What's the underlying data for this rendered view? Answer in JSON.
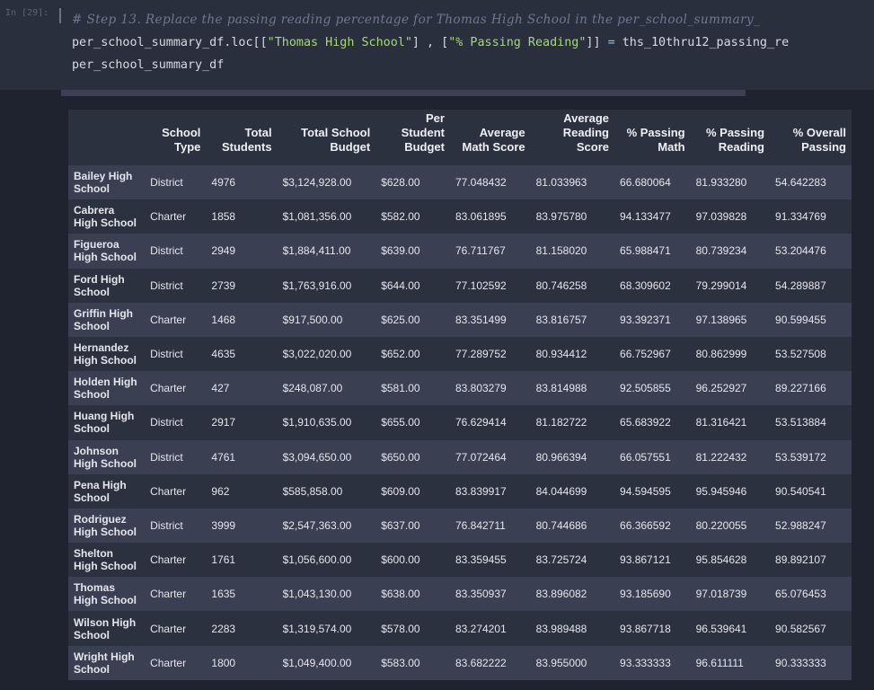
{
  "input_cell": {
    "prompt": "In [29]:",
    "comment": "# Step 13. Replace the passing reading percentage for Thomas High School in the per_school_summary_",
    "line2_pre": "per_school_summary_df.loc[[",
    "line2_str1": "\"Thomas High School\"",
    "line2_mid": "] , [",
    "line2_str2": "\"% Passing Reading\"",
    "line2_post": "]] ",
    "line2_eq": "=",
    "line2_tail": " ths_10thru12_passing_re",
    "line3": "per_school_summary_df"
  },
  "table": {
    "columns": [
      "School Type",
      "Total Students",
      "Total School Budget",
      "Per Student Budget",
      "Average Math Score",
      "Average Reading Score",
      "% Passing Math",
      "% Passing Reading",
      "% Overall Passing"
    ],
    "rows": [
      {
        "school": "Bailey High School",
        "cells": [
          "District",
          "4976",
          "$3,124,928.00",
          "$628.00",
          "77.048432",
          "81.033963",
          "66.680064",
          "81.933280",
          "54.642283"
        ]
      },
      {
        "school": "Cabrera High School",
        "cells": [
          "Charter",
          "1858",
          "$1,081,356.00",
          "$582.00",
          "83.061895",
          "83.975780",
          "94.133477",
          "97.039828",
          "91.334769"
        ]
      },
      {
        "school": "Figueroa High School",
        "cells": [
          "District",
          "2949",
          "$1,884,411.00",
          "$639.00",
          "76.711767",
          "81.158020",
          "65.988471",
          "80.739234",
          "53.204476"
        ]
      },
      {
        "school": "Ford High School",
        "cells": [
          "District",
          "2739",
          "$1,763,916.00",
          "$644.00",
          "77.102592",
          "80.746258",
          "68.309602",
          "79.299014",
          "54.289887"
        ]
      },
      {
        "school": "Griffin High School",
        "cells": [
          "Charter",
          "1468",
          "$917,500.00",
          "$625.00",
          "83.351499",
          "83.816757",
          "93.392371",
          "97.138965",
          "90.599455"
        ]
      },
      {
        "school": "Hernandez High School",
        "cells": [
          "District",
          "4635",
          "$3,022,020.00",
          "$652.00",
          "77.289752",
          "80.934412",
          "66.752967",
          "80.862999",
          "53.527508"
        ]
      },
      {
        "school": "Holden High School",
        "cells": [
          "Charter",
          "427",
          "$248,087.00",
          "$581.00",
          "83.803279",
          "83.814988",
          "92.505855",
          "96.252927",
          "89.227166"
        ]
      },
      {
        "school": "Huang High School",
        "cells": [
          "District",
          "2917",
          "$1,910,635.00",
          "$655.00",
          "76.629414",
          "81.182722",
          "65.683922",
          "81.316421",
          "53.513884"
        ]
      },
      {
        "school": "Johnson High School",
        "cells": [
          "District",
          "4761",
          "$3,094,650.00",
          "$650.00",
          "77.072464",
          "80.966394",
          "66.057551",
          "81.222432",
          "53.539172"
        ]
      },
      {
        "school": "Pena High School",
        "cells": [
          "Charter",
          "962",
          "$585,858.00",
          "$609.00",
          "83.839917",
          "84.044699",
          "94.594595",
          "95.945946",
          "90.540541"
        ]
      },
      {
        "school": "Rodriguez High School",
        "cells": [
          "District",
          "3999",
          "$2,547,363.00",
          "$637.00",
          "76.842711",
          "80.744686",
          "66.366592",
          "80.220055",
          "52.988247"
        ]
      },
      {
        "school": "Shelton High School",
        "cells": [
          "Charter",
          "1761",
          "$1,056,600.00",
          "$600.00",
          "83.359455",
          "83.725724",
          "93.867121",
          "95.854628",
          "89.892107"
        ]
      },
      {
        "school": "Thomas High School",
        "cells": [
          "Charter",
          "1635",
          "$1,043,130.00",
          "$638.00",
          "83.350937",
          "83.896082",
          "93.185690",
          "97.018739",
          "65.076453"
        ]
      },
      {
        "school": "Wilson High School",
        "cells": [
          "Charter",
          "2283",
          "$1,319,574.00",
          "$578.00",
          "83.274201",
          "83.989488",
          "93.867718",
          "96.539641",
          "90.582567"
        ]
      },
      {
        "school": "Wright High School",
        "cells": [
          "Charter",
          "1800",
          "$1,049,400.00",
          "$583.00",
          "83.682222",
          "83.955000",
          "93.333333",
          "96.611111",
          "90.333333"
        ]
      }
    ]
  },
  "colors": {
    "background": "#1f2330",
    "row_dark": "#2c3140",
    "row_light": "#3a4052",
    "string": "#a6d682",
    "comment": "#6f7890"
  }
}
